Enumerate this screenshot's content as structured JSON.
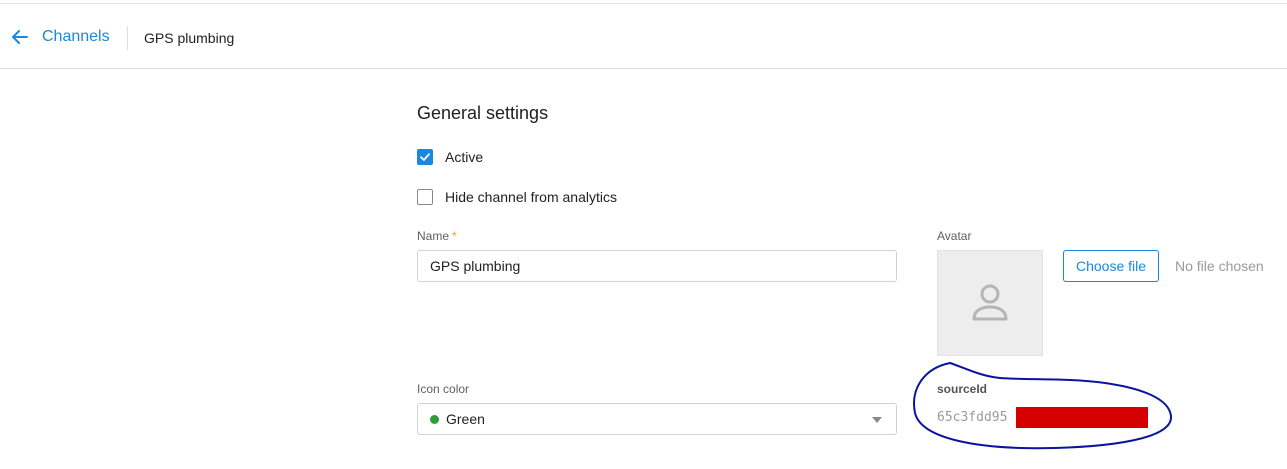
{
  "header": {
    "back_label": "Channels",
    "breadcrumb": "GPS plumbing"
  },
  "general": {
    "title": "General settings",
    "active_label": "Active",
    "active_checked": true,
    "hide_label": "Hide channel from analytics",
    "hide_checked": false
  },
  "name_field": {
    "label": "Name",
    "required_mark": "*",
    "value": "GPS plumbing"
  },
  "avatar": {
    "label": "Avatar",
    "choose_button": "Choose file",
    "file_status": "No file chosen"
  },
  "icon_color": {
    "label": "Icon color",
    "value": "Green",
    "dot_color": "#2e9e3c"
  },
  "source": {
    "label": "sourceId",
    "value_visible": "65c3fdd95"
  },
  "colors": {
    "accent": "#1a88e0",
    "annotation_circle": "#0a14a0",
    "redaction": "#d40000"
  }
}
